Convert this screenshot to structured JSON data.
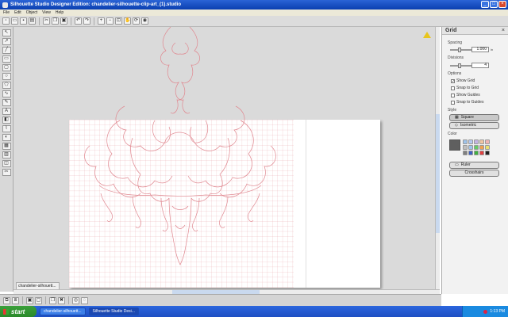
{
  "window": {
    "title": "Silhouette Studio Designer Edition: chandelier-silhouette-clip-art_(1).studio"
  },
  "menu": [
    "File",
    "Edit",
    "Object",
    "View",
    "Help"
  ],
  "toolbar": {
    "icons": [
      "new-icon",
      "open-icon",
      "save-icon",
      "print-icon",
      "cut-icon",
      "copy-icon",
      "paste-icon",
      "undo-icon",
      "redo-icon",
      "zoom-in-icon",
      "zoom-out-icon",
      "zoom-fit-icon",
      "pan-icon",
      "redraw-icon",
      "weld-icon"
    ]
  },
  "document": {
    "tab_label": "chandelier-silhouett..."
  },
  "grid_panel": {
    "title": "Grid",
    "spacing_label": "Spacing",
    "spacing_value": "1.000",
    "spacing_unit": "in",
    "divisions_label": "Divisions",
    "divisions_value": "4",
    "options_label": "Options",
    "options": [
      {
        "label": "Show Grid",
        "checked": true
      },
      {
        "label": "Snap to Grid",
        "checked": false
      },
      {
        "label": "Show Guides",
        "checked": false
      },
      {
        "label": "Snap to Guides",
        "checked": false
      }
    ],
    "style_label": "Style",
    "styles": [
      "Square",
      "Isometric"
    ],
    "selected_style": "Square",
    "color_label": "Color",
    "current_color": "#5f5f5f",
    "colors": [
      "#9ec3ea",
      "#b4c8f0",
      "#c4b4e4",
      "#f0c4a0",
      "#f0b4b4",
      "#c0c0c0",
      "#9ec3ea",
      "#66cc66",
      "#f0a050",
      "#e8e070",
      "#808080",
      "#4060c0",
      "#40b040",
      "#e04040",
      "#202020"
    ],
    "ruler_label": "Ruler",
    "crosshairs_label": "Crosshairs"
  },
  "taskbar": {
    "start_label": "start",
    "items": [
      {
        "label": "chandelier-silhouett...",
        "active": false
      },
      {
        "label": "Silhouette Studio Desi...",
        "active": true
      }
    ],
    "clock": "1:13 PM"
  },
  "colors": {
    "grid_line": "#e8a0a8",
    "design_stroke": "#e08890",
    "workspace_bg": "#dadada"
  }
}
